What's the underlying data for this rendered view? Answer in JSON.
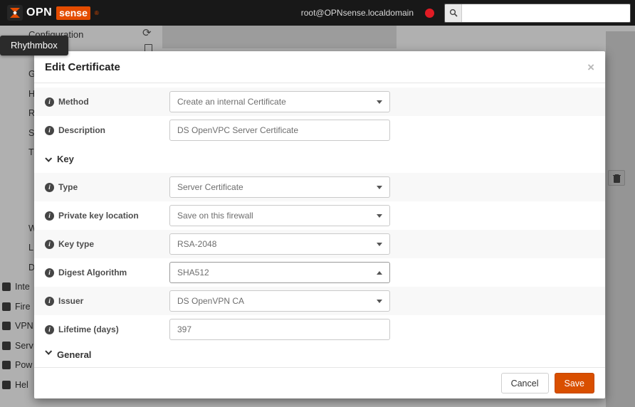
{
  "topbar": {
    "brand_opn": "OPN",
    "brand_sense": "sense",
    "brand_reg": "®",
    "user": "root@OPNsense.localdomain"
  },
  "tooltip": {
    "label": "Rhythmbox"
  },
  "icons": {
    "info": "i",
    "refresh": "⟳"
  },
  "background": {
    "config_label": "Configuration",
    "left_letters": [
      "G",
      "H",
      "R",
      "S",
      "T"
    ],
    "mid_letters": [
      "W",
      "L",
      "D"
    ],
    "sidebar_items": [
      {
        "label": "Inte"
      },
      {
        "label": "Fire"
      },
      {
        "label": "VPN"
      },
      {
        "label": "Serv"
      },
      {
        "label": "Pow"
      },
      {
        "label": "Hel"
      }
    ]
  },
  "modal": {
    "title": "Edit Certificate",
    "close_label": "×",
    "rows": [
      {
        "label": "Method",
        "value": "Create an internal Certificate"
      },
      {
        "label": "Description",
        "value": "DS OpenVPC Server Certificate"
      },
      {
        "label": "Key"
      },
      {
        "label": "Type",
        "value": "Server Certificate"
      },
      {
        "label": "Private key location",
        "value": "Save on this firewall"
      },
      {
        "label": "Key type",
        "value": "RSA-2048"
      },
      {
        "label": "Digest Algorithm",
        "value": "SHA512"
      },
      {
        "label": "Issuer",
        "value": "DS OpenVPN CA"
      },
      {
        "label": "Lifetime (days)",
        "value": "397"
      },
      {
        "label": "General"
      }
    ],
    "footer": {
      "cancel_label": "Cancel",
      "save_label": "Save"
    }
  },
  "colors": {
    "accent": "#d94f00",
    "danger": "#e01b24"
  }
}
